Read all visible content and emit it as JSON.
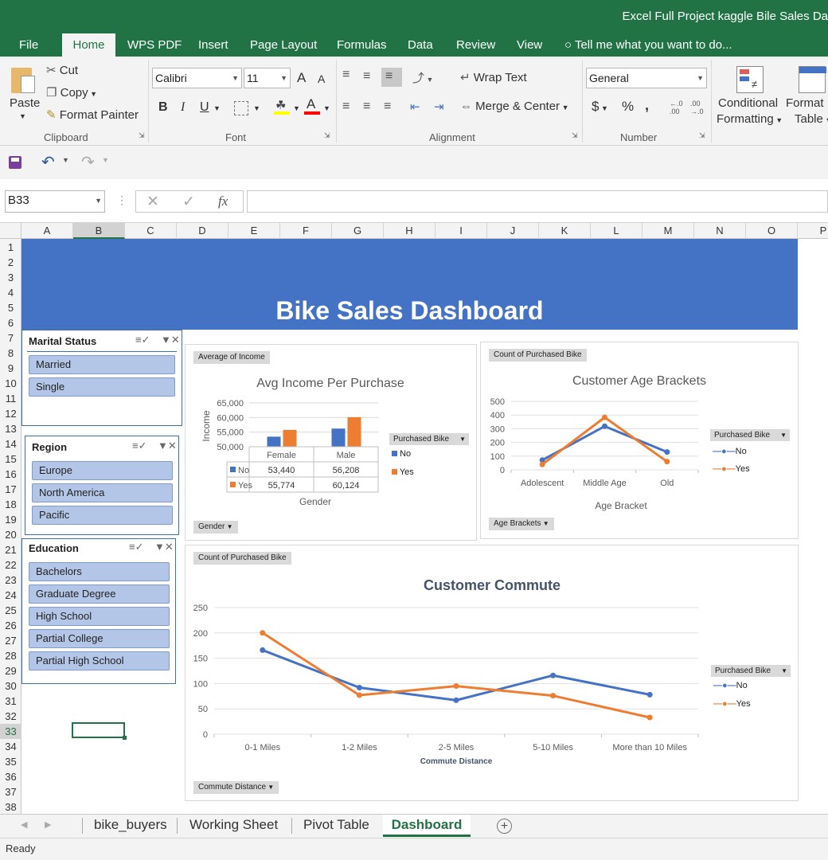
{
  "window": {
    "title": "Excel Full Project kaggle Bile Sales Da"
  },
  "ribbon_tabs": [
    {
      "label": "File"
    },
    {
      "label": "Home"
    },
    {
      "label": "WPS PDF"
    },
    {
      "label": "Insert"
    },
    {
      "label": "Page Layout"
    },
    {
      "label": "Formulas"
    },
    {
      "label": "Data"
    },
    {
      "label": "Review"
    },
    {
      "label": "View"
    },
    {
      "label": "Tell me what you want to do..."
    }
  ],
  "ribbon": {
    "clipboard": {
      "paste": "Paste",
      "cut": "Cut",
      "copy": "Copy",
      "format_painter": "Format Painter",
      "group": "Clipboard"
    },
    "font": {
      "name": "Calibri",
      "size": "11",
      "group": "Font",
      "bold": "B",
      "italic": "I",
      "underline": "U",
      "grow": "A",
      "shrink": "A"
    },
    "alignment": {
      "wrap": "Wrap Text",
      "merge": "Merge & Center",
      "group": "Alignment"
    },
    "number": {
      "format": "General",
      "group": "Number",
      "currency": "$",
      "percent": "%",
      "comma": ","
    },
    "styles": {
      "conditional1": "Conditional",
      "conditional2": "Formatting",
      "format1": "Format",
      "format2": "Table"
    }
  },
  "formula_bar": {
    "name_box": "B33",
    "fx": "fx",
    "value": ""
  },
  "columns": [
    "A",
    "B",
    "C",
    "D",
    "E",
    "F",
    "G",
    "H",
    "I",
    "J",
    "K",
    "L",
    "M",
    "N",
    "O",
    "P"
  ],
  "rows": [
    "1",
    "2",
    "3",
    "4",
    "5",
    "6",
    "7",
    "8",
    "9",
    "10",
    "11",
    "12",
    "13",
    "14",
    "15",
    "16",
    "17",
    "18",
    "19",
    "20",
    "21",
    "22",
    "23",
    "24",
    "25",
    "26",
    "27",
    "28",
    "29",
    "30",
    "31",
    "32",
    "33",
    "34",
    "35",
    "36",
    "37",
    "38"
  ],
  "dashboard": {
    "title": "Bike Sales Dashboard"
  },
  "slicers": {
    "marital": {
      "header": "Marital Status",
      "items": [
        "Married",
        "Single"
      ]
    },
    "region": {
      "header": "Region",
      "items": [
        "Europe",
        "North America",
        "Pacific"
      ]
    },
    "education": {
      "header": "Education",
      "items": [
        "Bachelors",
        "Graduate Degree",
        "High School",
        "Partial College",
        "Partial High School"
      ]
    }
  },
  "colors": {
    "blue": "#4472c4",
    "orange": "#ed7d31",
    "excel_green": "#217346"
  },
  "chart_data": [
    {
      "type": "bar",
      "title": "Avg Income Per Purchase",
      "field_button": "Average of Income",
      "axis_button": "Gender",
      "ylabel": "Income",
      "xlabel": "Gender",
      "categories": [
        "Female",
        "Male"
      ],
      "series": [
        {
          "name": "No",
          "values": [
            53440,
            56208
          ],
          "labels": [
            "53,440",
            "56,208"
          ]
        },
        {
          "name": "Yes",
          "values": [
            55774,
            60124
          ],
          "labels": [
            "55,774",
            "60,124"
          ]
        }
      ],
      "ylim": [
        50000,
        65000
      ],
      "yticks": [
        "65,000",
        "60,000",
        "55,000",
        "50,000"
      ],
      "legend_title": "Purchased Bike",
      "legend": "right"
    },
    {
      "type": "line",
      "title": "Customer Age Brackets",
      "field_button": "Count of Purchased Bike",
      "axis_button": "Age Brackets",
      "xlabel": "Age Bracket",
      "categories": [
        "Adolescent",
        "Middle Age",
        "Old"
      ],
      "series": [
        {
          "name": "No",
          "values": [
            71,
            318,
            130
          ]
        },
        {
          "name": "Yes",
          "values": [
            39,
            383,
            60
          ]
        }
      ],
      "ylim": [
        0,
        500
      ],
      "yticks": [
        "500",
        "400",
        "300",
        "200",
        "100",
        "0"
      ],
      "legend_title": "Purchased Bike",
      "legend": "right"
    },
    {
      "type": "line",
      "title": "Customer Commute",
      "field_button": "Count of Purchased Bike",
      "axis_button": "Commute Distance",
      "xlabel": "Commute Distance",
      "categories": [
        "0-1 Miles",
        "1-2 Miles",
        "2-5 Miles",
        "5-10 Miles",
        "More than 10 Miles"
      ],
      "series": [
        {
          "name": "No",
          "values": [
            166,
            92,
            67,
            116,
            78
          ]
        },
        {
          "name": "Yes",
          "values": [
            200,
            77,
            95,
            76,
            33
          ]
        }
      ],
      "ylim": [
        0,
        250
      ],
      "yticks": [
        "250",
        "200",
        "150",
        "100",
        "50",
        "0"
      ],
      "legend_title": "Purchased Bike",
      "legend": "right"
    }
  ],
  "sheet_tabs": [
    {
      "label": "bike_buyers"
    },
    {
      "label": "Working Sheet"
    },
    {
      "label": "Pivot Table"
    },
    {
      "label": "Dashboard"
    }
  ],
  "status": {
    "text": "Ready"
  }
}
